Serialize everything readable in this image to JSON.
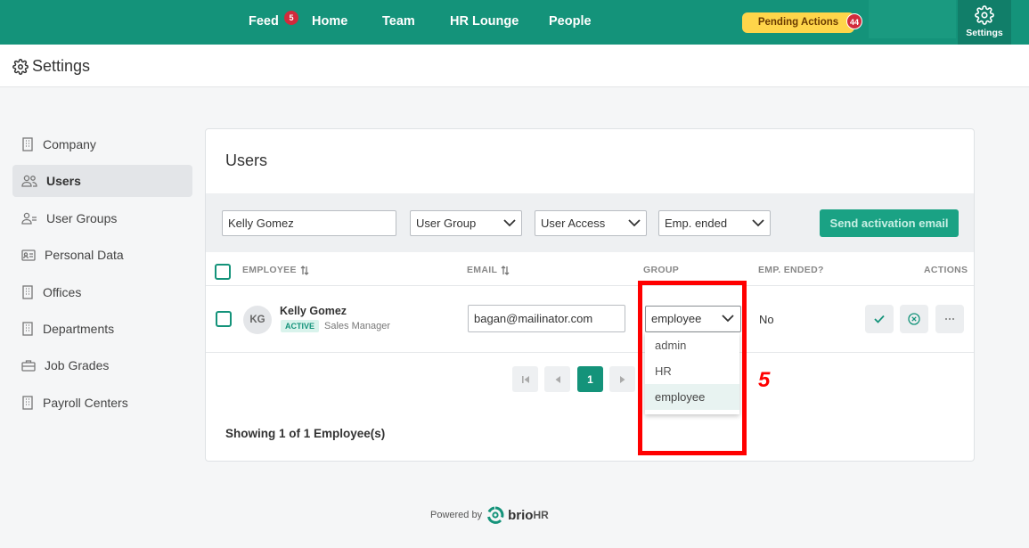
{
  "nav": {
    "items": [
      "Feed",
      "Home",
      "Team",
      "HR Lounge",
      "People"
    ],
    "feed_badge": "5",
    "pending_label": "Pending Actions",
    "pending_count": "44",
    "settings_label": "Settings"
  },
  "page": {
    "title": "Settings"
  },
  "sidebar": {
    "items": [
      {
        "label": "Company",
        "icon": "building-icon"
      },
      {
        "label": "Users",
        "icon": "users-icon",
        "active": true
      },
      {
        "label": "User Groups",
        "icon": "user-groups-icon"
      },
      {
        "label": "Personal Data",
        "icon": "id-card-icon"
      },
      {
        "label": "Offices",
        "icon": "building-icon"
      },
      {
        "label": "Departments",
        "icon": "building-icon"
      },
      {
        "label": "Job Grades",
        "icon": "briefcase-icon"
      },
      {
        "label": "Payroll Centers",
        "icon": "building-icon"
      }
    ]
  },
  "users": {
    "title": "Users",
    "search_value": "Kelly Gomez",
    "filters": [
      "User Group",
      "User Access",
      "Emp. ended"
    ],
    "send_button": "Send activation email",
    "columns": [
      "EMPLOYEE",
      "EMAIL",
      "GROUP",
      "EMP. ENDED?",
      "ACTIONS"
    ],
    "rows": [
      {
        "initials": "KG",
        "name": "Kelly Gomez",
        "status": "ACTIVE",
        "role": "Sales Manager",
        "email": "bagan@mailinator.com",
        "group": "employee",
        "ended": "No"
      }
    ],
    "group_options": [
      "admin",
      "HR",
      "employee"
    ],
    "page": "1",
    "showing": "Showing 1 of 1 Employee(s)"
  },
  "annotation": {
    "number": "5",
    "color": "#ff0000"
  },
  "footer": {
    "powered_by": "Powered by",
    "brand": "brio",
    "brand_suffix": "HR"
  },
  "colors": {
    "brand": "#14937a",
    "pending": "#ffd54a",
    "badge": "#d22a3c"
  }
}
